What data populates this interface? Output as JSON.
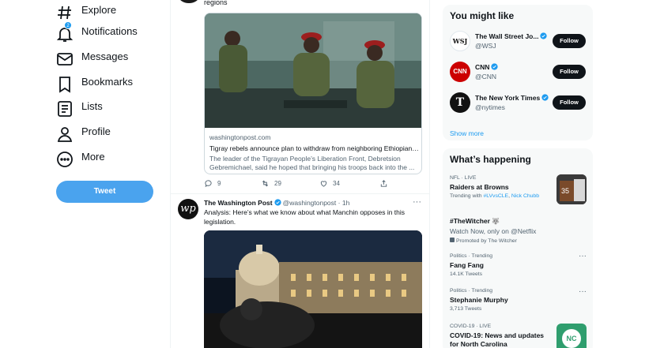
{
  "nav": {
    "items": [
      {
        "label": "Explore",
        "icon": "hashtag-icon"
      },
      {
        "label": "Notifications",
        "icon": "bell-icon",
        "badge": "2"
      },
      {
        "label": "Messages",
        "icon": "envelope-icon"
      },
      {
        "label": "Bookmarks",
        "icon": "bookmark-icon"
      },
      {
        "label": "Lists",
        "icon": "list-icon"
      },
      {
        "label": "Profile",
        "icon": "person-icon"
      },
      {
        "label": "More",
        "icon": "more-circle-icon"
      }
    ],
    "tweet_label": "Tweet"
  },
  "feed": {
    "prev_tweet_tail": "regions",
    "card": {
      "domain": "washingtonpost.com",
      "title": "Tigray rebels announce plan to withdraw from neighboring Ethiopian r...",
      "description": "The leader of the Tigrayan People’s Liberation Front, Debretsion Gebremichael, said he hoped that bringing his troops back into the ..."
    },
    "actions": {
      "replies": "9",
      "retweets": "29",
      "likes": "34"
    },
    "tweet2": {
      "avatar_text": "wp",
      "name": "The Washington Post",
      "handle": "@washingtonpost",
      "time": "· 1h",
      "text": "Analysis: Here’s what we know about what Manchin opposes in this legislation."
    }
  },
  "who_to_follow": {
    "title": "You might like",
    "accounts": [
      {
        "name": "The Wall Street Jo...",
        "handle": "@WSJ",
        "avatar_text": "WSJ",
        "follow_label": "Follow"
      },
      {
        "name": "CNN",
        "handle": "@CNN",
        "avatar_text": "CNN",
        "follow_label": "Follow"
      },
      {
        "name": "The New York Times",
        "handle": "@nytimes",
        "avatar_text": "T",
        "follow_label": "Follow"
      }
    ],
    "show_more": "Show more"
  },
  "whats_happening": {
    "title": "What’s happening",
    "trends": [
      {
        "meta": "NFL · LIVE",
        "title": "Raiders at Browns",
        "sub_prefix": "Trending with",
        "links": [
          "#LVvsCLE",
          "Nick Chubb"
        ]
      },
      {
        "meta": "",
        "title": "#TheWitcher",
        "sub": "Watch Now, only on @Netflix",
        "promoted": "Promoted by The Witcher"
      },
      {
        "meta": "Politics · Trending",
        "title": "Fang Fang",
        "sub": "14.1K Tweets"
      },
      {
        "meta": "Politics · Trending",
        "title": "Stephanie Murphy",
        "sub": "3,713 Tweets"
      },
      {
        "meta": "COVID-19 · LIVE",
        "title": "COVID-19: News and updates for North Carolina",
        "thumb_text": "NC"
      }
    ]
  },
  "colors": {
    "accent": "#1d9bf0",
    "tweet_button": "#4aa3ee",
    "text": "#0f1419",
    "muted": "#536471",
    "panel": "#f7f9f9"
  }
}
